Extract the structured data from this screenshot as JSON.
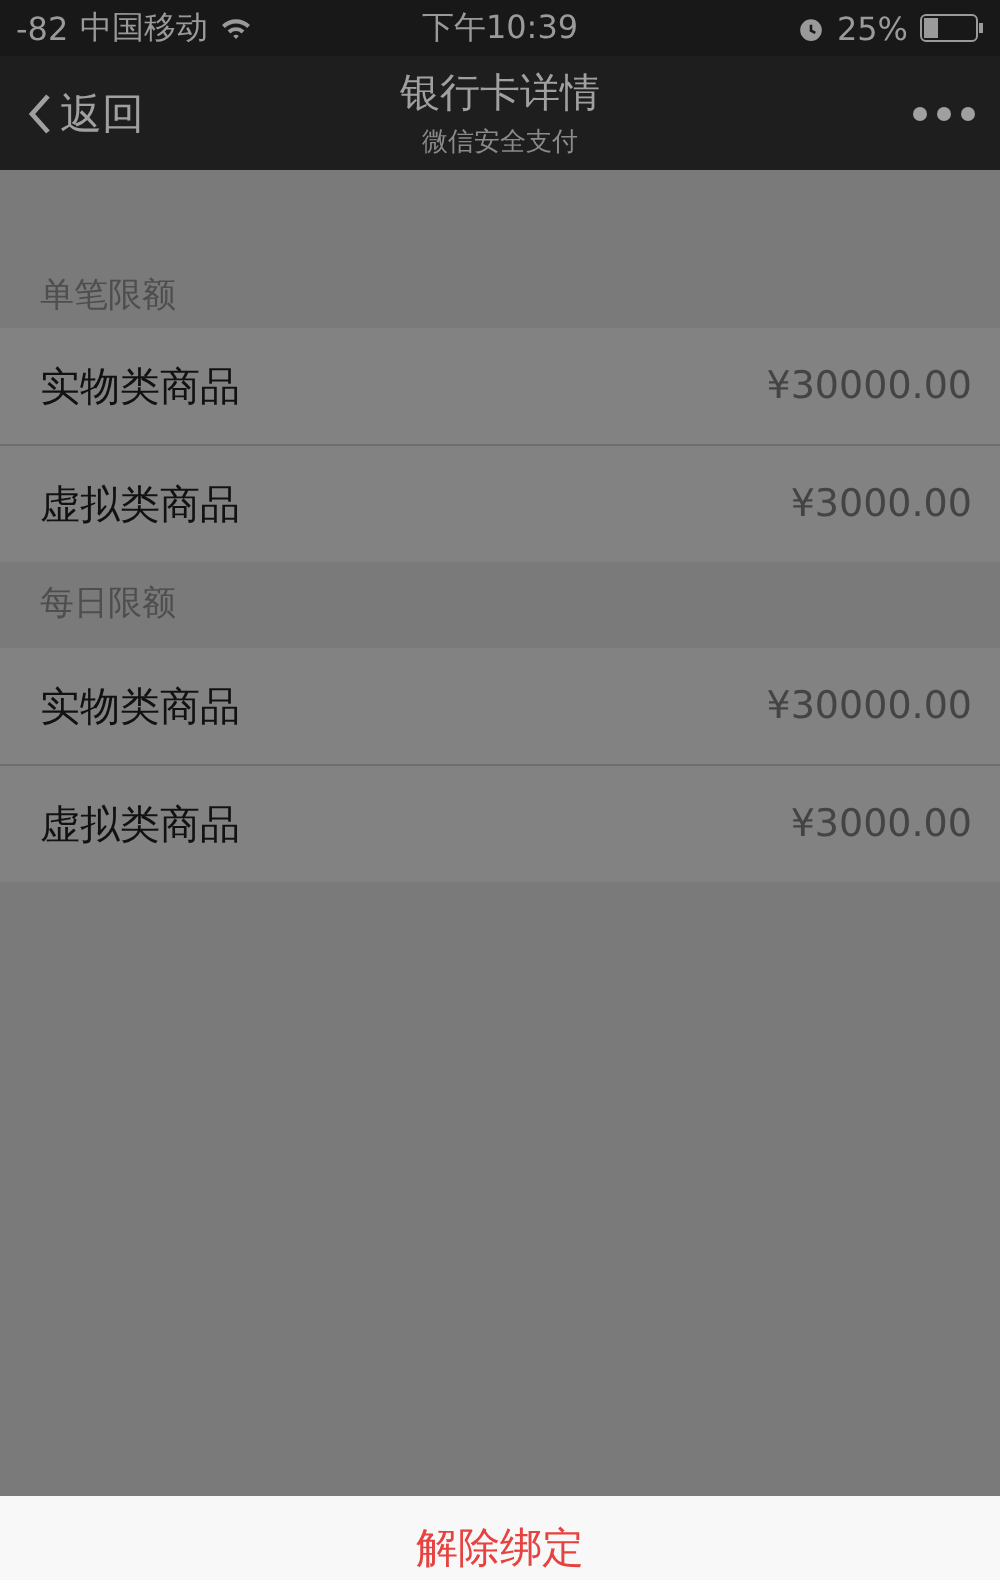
{
  "status_bar": {
    "signal": "-82",
    "carrier": "中国移动",
    "time": "下午10:39",
    "battery": "25%"
  },
  "nav": {
    "back": "返回",
    "title": "银行卡详情",
    "subtitle": "微信安全支付"
  },
  "sections": [
    {
      "title": "单笔限额",
      "rows": [
        {
          "label": "实物类商品",
          "value": "¥30000.00"
        },
        {
          "label": "虚拟类商品",
          "value": "¥3000.00"
        }
      ]
    },
    {
      "title": "每日限额",
      "rows": [
        {
          "label": "实物类商品",
          "value": "¥30000.00"
        },
        {
          "label": "虚拟类商品",
          "value": "¥3000.00"
        }
      ]
    }
  ],
  "action_sheet": {
    "actions": [
      {
        "label": "解除绑定",
        "kind": "destructive"
      }
    ]
  }
}
